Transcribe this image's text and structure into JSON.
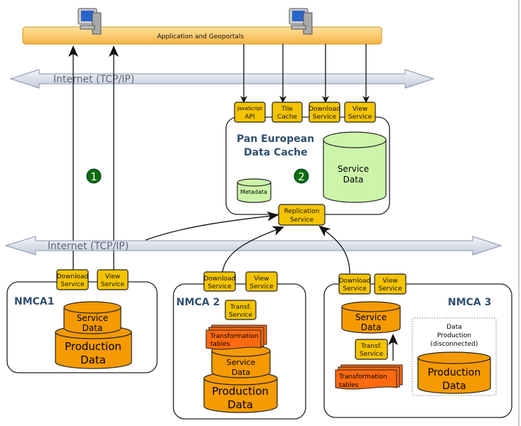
{
  "application_bar": {
    "label": "Application and Geoportals"
  },
  "internet_top": {
    "label": "Internet (TCP/IP)"
  },
  "internet_bottom": {
    "label": "Internet (TCP/IP)"
  },
  "markers": {
    "one": "1",
    "two": "2"
  },
  "pan_european": {
    "title_line1": "Pan European",
    "title_line2": "Data Cache",
    "services": [
      {
        "line1": "JavaScript",
        "line2": "API"
      },
      {
        "line1": "Tile",
        "line2": "Cache"
      },
      {
        "line1": "Download",
        "line2": "Service"
      },
      {
        "line1": "View",
        "line2": "Service"
      }
    ],
    "service_data": {
      "line1": "Service",
      "line2": "Data"
    },
    "metadata": "Metadata",
    "replication": {
      "line1": "Replication",
      "line2": "Service"
    }
  },
  "nmca1": {
    "title": "NMCA1",
    "download": {
      "line1": "Download",
      "line2": "Service"
    },
    "view": {
      "line1": "View",
      "line2": "Service"
    },
    "service_data": {
      "line1": "Service",
      "line2": "Data"
    },
    "production_data": {
      "line1": "Production",
      "line2": "Data"
    }
  },
  "nmca2": {
    "title": "NMCA 2",
    "download": {
      "line1": "Download",
      "line2": "Service"
    },
    "view": {
      "line1": "View",
      "line2": "Service"
    },
    "transf": {
      "line1": "Transf.",
      "line2": "Service"
    },
    "tables": {
      "line1": "Transformation",
      "line2": "tables"
    },
    "service_data": {
      "line1": "Service",
      "line2": "Data"
    },
    "production_data": {
      "line1": "Production",
      "line2": "Data"
    }
  },
  "nmca3": {
    "title": "NMCA 3",
    "download": {
      "line1": "Download",
      "line2": "Service"
    },
    "view": {
      "line1": "View",
      "line2": "Service"
    },
    "service_data": {
      "line1": "Service",
      "line2": "Data"
    },
    "transf": {
      "line1": "Transf.",
      "line2": "Service"
    },
    "tables": {
      "line1": "Transformation",
      "line2": "tables"
    },
    "disconnected": {
      "line1": "Data",
      "line2": "Production",
      "line3": "(disconnected)"
    },
    "production_data": {
      "line1": "Production",
      "line2": "Data"
    }
  },
  "colors": {
    "service": "#f5c400",
    "orange_data": "#f59a00",
    "green_data": "#ccf5aa",
    "tables": "#ff6a10",
    "marker": "#0a6e0a",
    "title": "#2f4f6f"
  }
}
